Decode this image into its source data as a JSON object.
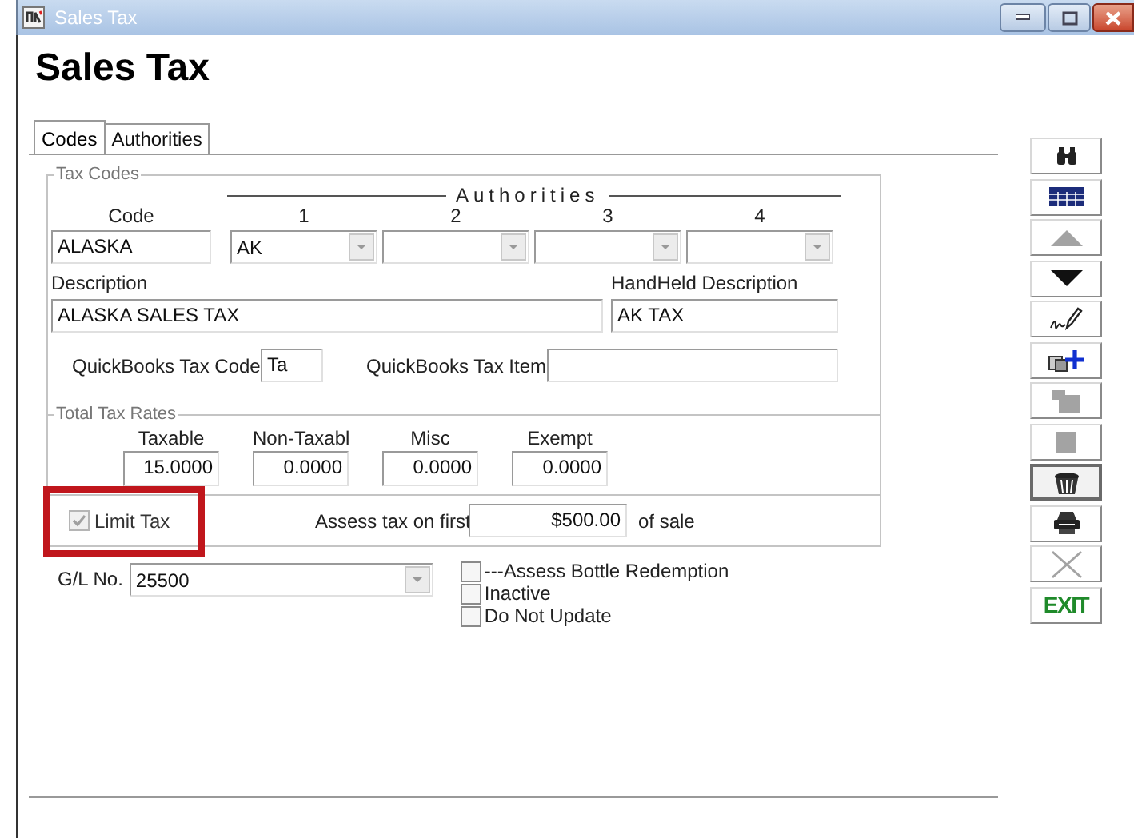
{
  "window": {
    "title": "Sales Tax"
  },
  "heading": "Sales Tax",
  "tabs": [
    {
      "label": "Codes",
      "selected": true
    },
    {
      "label": "Authorities",
      "selected": false
    }
  ],
  "tax_codes": {
    "legend": "Tax Codes",
    "authorities_header": "Authorities",
    "code_label": "Code",
    "code": "ALASKA",
    "authorities": [
      {
        "label": "1",
        "value": "AK"
      },
      {
        "label": "2"
      },
      {
        "label": "3"
      },
      {
        "label": "4"
      }
    ],
    "description_label": "Description",
    "description": "ALASKA SALES TAX",
    "handheld_label": "HandHeld Description",
    "handheld": "AK TAX",
    "qb_code_label": "QuickBooks Tax Code",
    "qb_code": "Ta",
    "qb_item_label": "QuickBooks Tax Item"
  },
  "total_tax_rates": {
    "legend": "Total Tax Rates",
    "rates": [
      {
        "label": "Taxable",
        "value": "15.0000"
      },
      {
        "label": "Non-Taxabl",
        "value": "0.0000"
      },
      {
        "label": "Misc",
        "value": "0.0000"
      },
      {
        "label": "Exempt",
        "value": "0.0000"
      }
    ]
  },
  "limit": {
    "label": "Limit Tax",
    "checked": true,
    "disabled": true,
    "highlighted": true,
    "assess_label": "Assess tax on first",
    "amount": "$500.00",
    "suffix": "of sale"
  },
  "gl": {
    "label": "G/L No.",
    "value": "25500"
  },
  "options": [
    {
      "label": "---Assess Bottle Redemption",
      "checked": false
    },
    {
      "label": "Inactive",
      "checked": false
    },
    {
      "label": "Do Not Update",
      "checked": false
    }
  ],
  "toolbar": [
    {
      "kind": "find",
      "disabled": false,
      "focused": false
    },
    {
      "kind": "table",
      "disabled": false,
      "focused": false
    },
    {
      "kind": "previous",
      "disabled": true,
      "focused": false
    },
    {
      "kind": "next",
      "disabled": false,
      "focused": false
    },
    {
      "kind": "edit",
      "disabled": false,
      "focused": false
    },
    {
      "kind": "add",
      "disabled": false,
      "focused": false
    },
    {
      "kind": "open",
      "disabled": true,
      "focused": false
    },
    {
      "kind": "stop",
      "disabled": true,
      "focused": false
    },
    {
      "kind": "delete",
      "disabled": false,
      "focused": true
    },
    {
      "kind": "print",
      "disabled": false,
      "focused": false
    },
    {
      "kind": "cancel",
      "disabled": true,
      "focused": false
    },
    {
      "kind": "exit",
      "label": "EXIT",
      "disabled": false,
      "focused": false
    }
  ]
}
